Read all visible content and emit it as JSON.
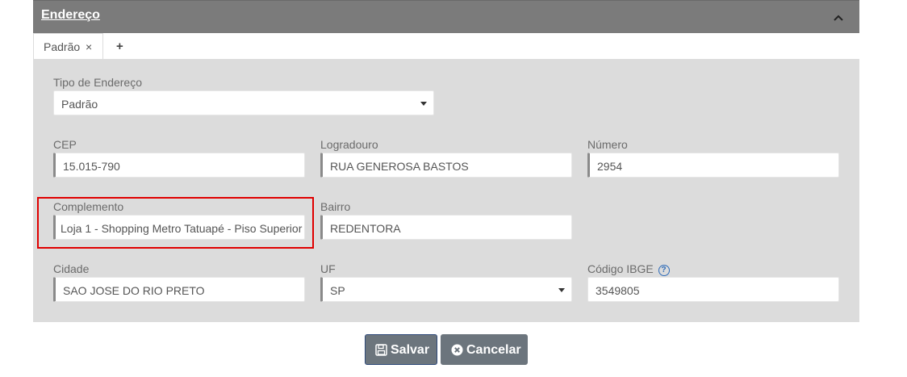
{
  "panel": {
    "title": "Endereço"
  },
  "tabs": {
    "active_label": "Padrão",
    "close_glyph": "×",
    "add_glyph": "+"
  },
  "form": {
    "tipo_endereco": {
      "label": "Tipo de Endereço",
      "value": "Padrão"
    },
    "cep": {
      "label": "CEP",
      "value": "15.015-790"
    },
    "logradouro": {
      "label": "Logradouro",
      "value": "RUA GENEROSA BASTOS"
    },
    "numero": {
      "label": "Número",
      "value": "2954"
    },
    "complemento": {
      "label": "Complemento",
      "value": "Loja 1 - Shopping Metro Tatuapé - Piso Superior"
    },
    "bairro": {
      "label": "Bairro",
      "value": "REDENTORA"
    },
    "cidade": {
      "label": "Cidade",
      "value": "SAO JOSE DO RIO PRETO"
    },
    "uf": {
      "label": "UF",
      "value": "SP"
    },
    "codigo_ibge": {
      "label": "Código IBGE",
      "value": "3549805",
      "help_glyph": "?"
    }
  },
  "buttons": {
    "save_label": "Salvar",
    "cancel_label": "Cancelar"
  },
  "colors": {
    "header_bg": "#7b7b7b",
    "body_bg": "#dcdcdc",
    "highlight": "#e00000",
    "button_bg": "#6c757d",
    "help_icon": "#2e6bb8"
  },
  "icons": {
    "collapse": "chevron-up-icon",
    "save": "floppy-disk-icon",
    "cancel": "close-circle-icon",
    "help": "question-circle-icon"
  }
}
